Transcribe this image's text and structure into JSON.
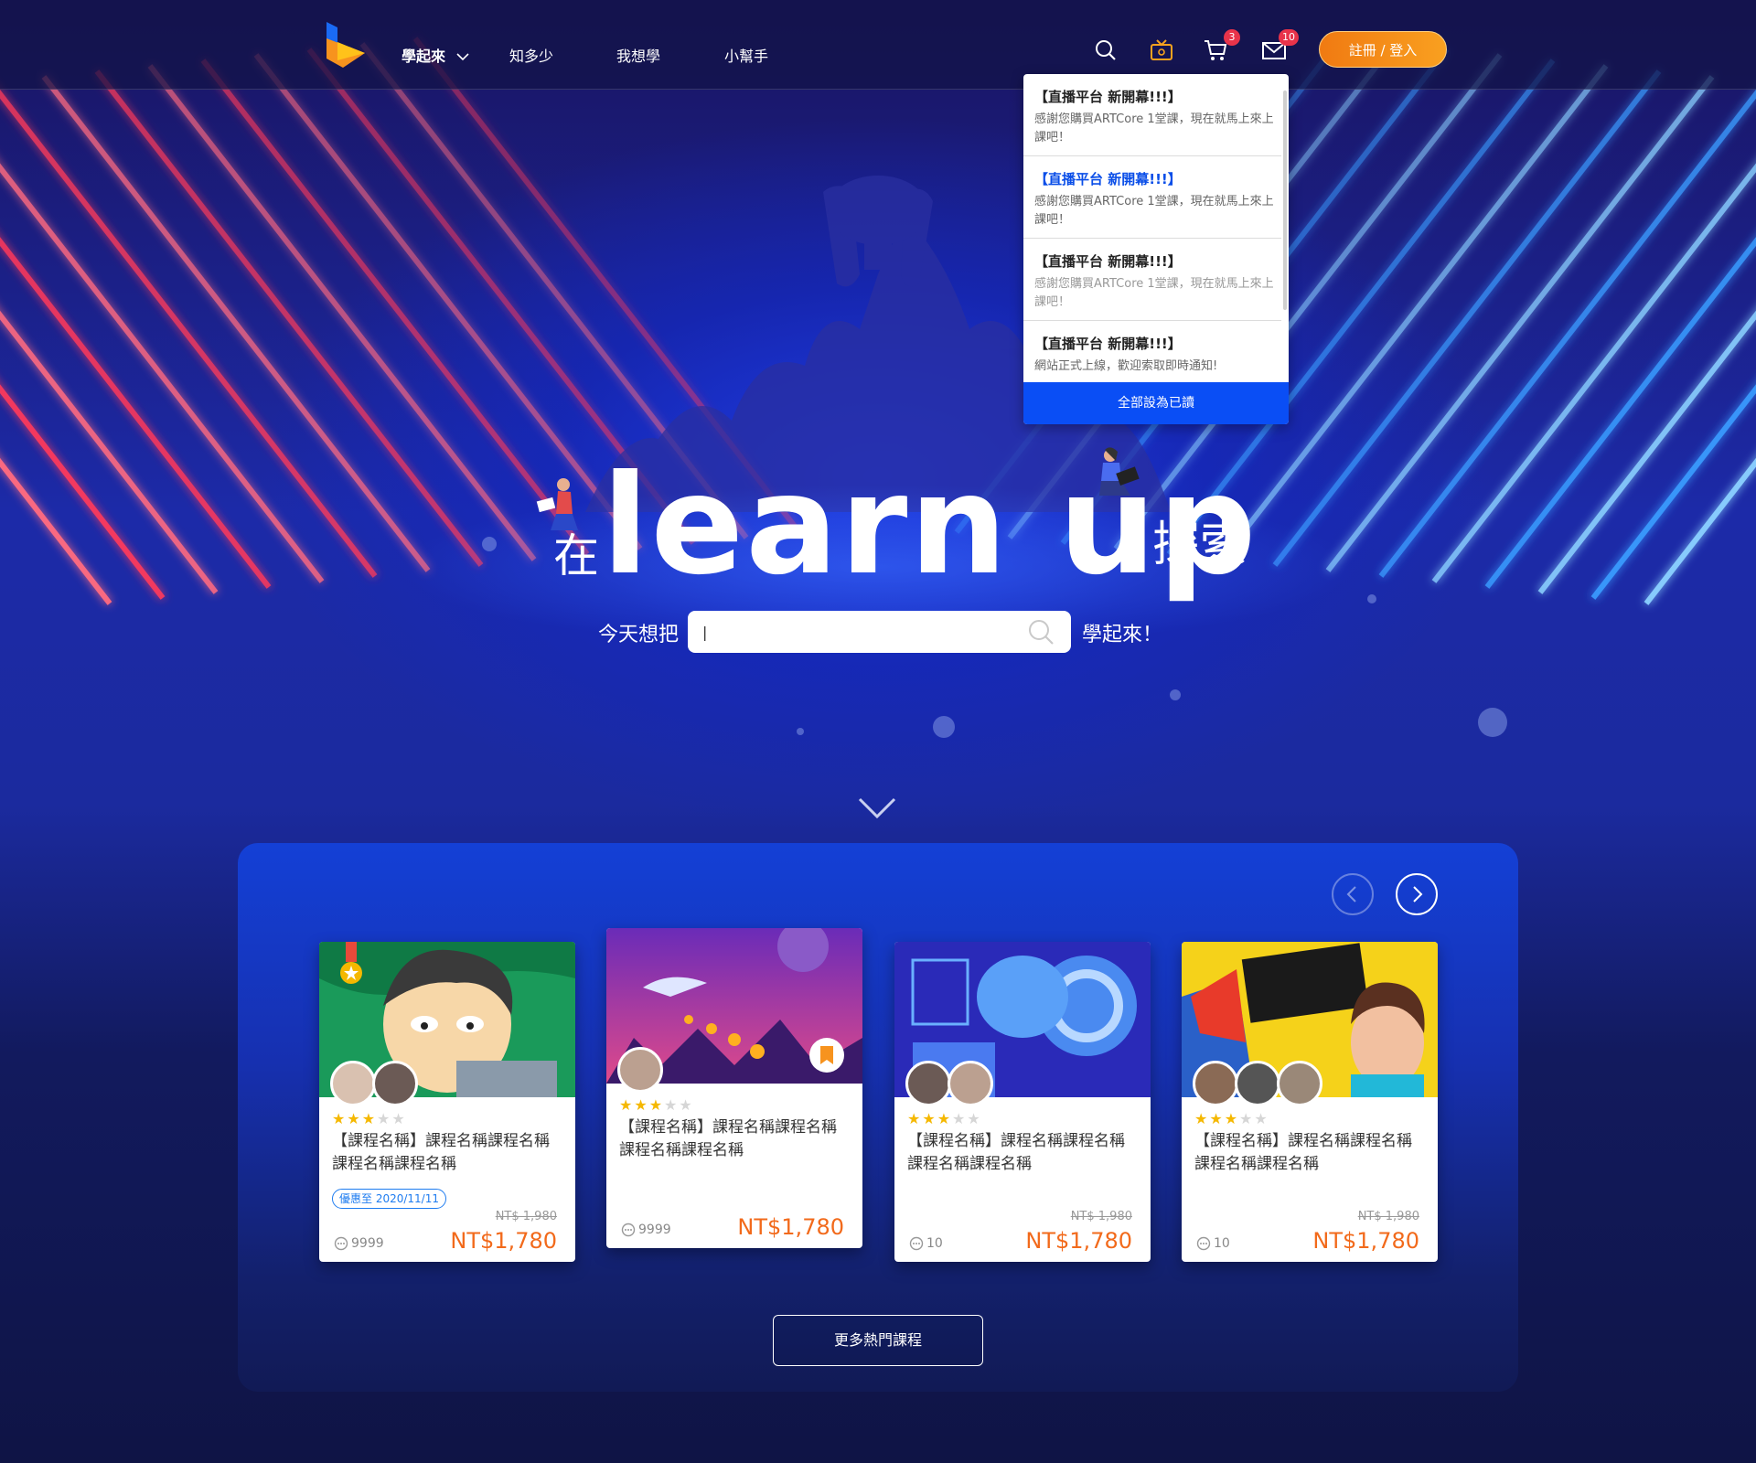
{
  "nav": {
    "items": [
      {
        "label": "學起來",
        "active": true
      },
      {
        "label": "知多少",
        "active": false
      },
      {
        "label": "我想學",
        "active": false
      },
      {
        "label": "小幫手",
        "active": false
      }
    ],
    "icons": [
      "search-icon",
      "live-tv-icon",
      "cart-icon",
      "mail-icon"
    ],
    "cart_count": "3",
    "mail_count": "10",
    "login_label": "註冊 / 登入"
  },
  "notifications": {
    "items": [
      {
        "title": "【直播平台 新開幕!!!】",
        "body": "感謝您購買ARTCore 1堂課，現在就馬上來上課吧！",
        "state": "read"
      },
      {
        "title": "【直播平台 新開幕!!!】",
        "body": "感謝您購買ARTCore 1堂課，現在就馬上來上課吧！",
        "state": "unread"
      },
      {
        "title": "【直播平台 新開幕!!!】",
        "body": "感謝您購買ARTCore 1堂課，現在就馬上來上課吧！",
        "state": "faded"
      },
      {
        "title": "【直播平台 新開幕!!!】",
        "body": "網站正式上線，歡迎索取即時通知!",
        "state": "read"
      }
    ],
    "mark_all_label": "全部設為已讀"
  },
  "hero": {
    "prefix": "在",
    "brand": "learn  up",
    "suffix": "探索",
    "search_pre": "今天想把",
    "search_post": "學起來！",
    "search_value": "|"
  },
  "courses": [
    {
      "title": "【課程名稱】課程名稱課程名稱課程名稱課程名稱",
      "rating": 3,
      "promo": "優惠至 2020/11/11",
      "orig_price": "NT$ 1,980",
      "price": "NT$1,780",
      "comments": "9999",
      "bookmarked": false,
      "medal": true
    },
    {
      "title": "【課程名稱】課程名稱課程名稱課程名稱課程名稱",
      "rating": 3,
      "promo": "",
      "orig_price": "",
      "price": "NT$1,780",
      "comments": "9999",
      "bookmarked": true,
      "medal": false
    },
    {
      "title": "【課程名稱】課程名稱課程名稱課程名稱課程名稱",
      "rating": 3,
      "promo": "",
      "orig_price": "NT$ 1,980",
      "price": "NT$1,780",
      "comments": "10",
      "bookmarked": false,
      "medal": false
    },
    {
      "title": "【課程名稱】課程名稱課程名稱課程名稱課程名稱",
      "rating": 3,
      "promo": "",
      "orig_price": "NT$ 1,980",
      "price": "NT$1,780",
      "comments": "10",
      "bookmarked": false,
      "medal": false
    }
  ],
  "more_courses_label": "更多熱門課程",
  "colors": {
    "accent_orange": "#f7931e",
    "notif_blue": "#0a4ef5",
    "price_orange": "#f26a1b",
    "star": "#f5b800"
  }
}
